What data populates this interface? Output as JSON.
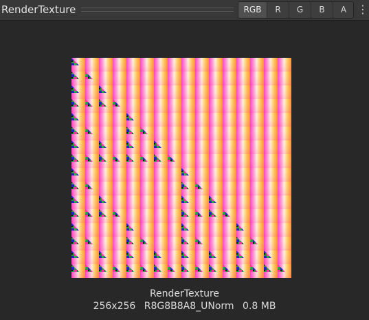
{
  "window": {
    "title": "RenderTexture"
  },
  "channels": [
    {
      "label": "RGB",
      "selected": true
    },
    {
      "label": "R",
      "selected": false
    },
    {
      "label": "G",
      "selected": false
    },
    {
      "label": "B",
      "selected": false
    },
    {
      "label": "A",
      "selected": false
    }
  ],
  "menu": {
    "icon": "more-vertical-icon"
  },
  "preview": {
    "texture_name": "RenderTexture",
    "dimensions": "256x256",
    "format": "R8G8B8A8_UNorm",
    "size": "0.8 MB"
  },
  "colors": {
    "background": "#282828",
    "toolbar": "#383838",
    "text": "#dcdcdc",
    "selected_button": "#4f4f4f"
  }
}
